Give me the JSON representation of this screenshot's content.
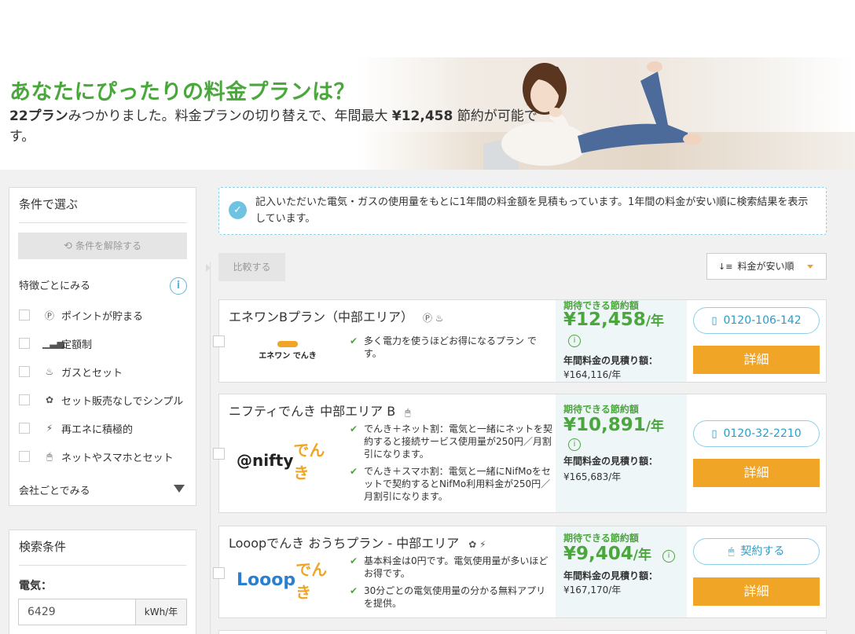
{
  "hero": {
    "title": "あなたにぴったりの料金プランは？",
    "count": "22プラン",
    "text_a": "みつかりました。料金プランの切り替えで、年間最大 ",
    "max_savings": "¥12,458",
    "text_b": " 節約が可能です。"
  },
  "sidebar": {
    "conditions_title": "条件で選ぶ",
    "reset_label": "条件を解除する",
    "feature_section": "特徴ごとにみる",
    "filters": [
      {
        "icon": "point-icon",
        "glyph": "Ⓟ",
        "label": "ポイントが貯まる"
      },
      {
        "icon": "bar-chart-icon",
        "glyph": "▁▃▅",
        "label": "定額制"
      },
      {
        "icon": "gas-flame-icon",
        "glyph": "♨",
        "label": "ガスとセット"
      },
      {
        "icon": "flower-icon",
        "glyph": "✿",
        "label": "セット販売なしでシンプル"
      },
      {
        "icon": "wind-turbine-icon",
        "glyph": "⚡",
        "label": "再エネに積極的"
      },
      {
        "icon": "mouse-icon",
        "glyph": "🖱",
        "label": "ネットやスマホとセット"
      }
    ],
    "company_section": "会社ごとでみる",
    "search_title": "検索条件",
    "electricity_label": "電気：",
    "kwh_value": "6429",
    "kwh_unit": "kWh/年"
  },
  "notice": {
    "text": "記入いただいた電気・ガスの使用量をもとに1年間の料金額を見積もっています。1年間の料金が安い順に検索結果を表示しています。"
  },
  "toolbar": {
    "compare_label": "比較する",
    "sort_label": "料金が安い順"
  },
  "plans": [
    {
      "name": "エネワンBプラン（中部エリア）",
      "icons": "Ⓟ ♨",
      "logo_text": "エネワン でんき",
      "features": [
        "多く電力を使うほどお得になるプラン です。"
      ],
      "savings_label": "期待できる節約額",
      "savings": "¥12,458",
      "per_year": "/年",
      "estimate_label": "年間料金の見積り額：",
      "estimate": "¥164,116/年",
      "cta": "0120-106-142",
      "detail": "詳細"
    },
    {
      "name": "ニフティでんき 中部エリア B",
      "icons": "🖱",
      "logo_text_a": "@nifty",
      "logo_text_b": "でんき",
      "features": [
        "でんき＋ネット割：電気と一緒にネットを契約すると接続サービス使用量が250円／月割引になります。",
        "でんき＋スマホ割：電気と一緒にNifMoをセットで契約するとNifMo利用料金が250円／月割引になります。"
      ],
      "savings_label": "期待できる節約額",
      "savings": "¥10,891",
      "per_year": "/年",
      "estimate_label": "年間料金の見積り額：",
      "estimate": "¥165,683/年",
      "cta": "0120-32-2210",
      "detail": "詳細"
    },
    {
      "name": "Looopでんき おうちプラン - 中部エリア",
      "icons": "✿ ⚡",
      "logo_text_a": "Looop",
      "logo_text_b": "でんき",
      "features": [
        "基本料金は0円です。電気使用量が多いほどお得です。",
        "30分ごとの電気使用量の分かる無料アプリを提供。"
      ],
      "savings_label": "期待できる節約額",
      "savings": "¥9,404",
      "per_year": "/年",
      "estimate_label": "年間料金の見積り額：",
      "estimate": "¥167,170/年",
      "cta": "契約する",
      "detail": "詳細"
    }
  ],
  "colors": {
    "accent_green": "#4aa73c",
    "cta_orange": "#f0a527",
    "link_blue": "#2b9dc8"
  }
}
